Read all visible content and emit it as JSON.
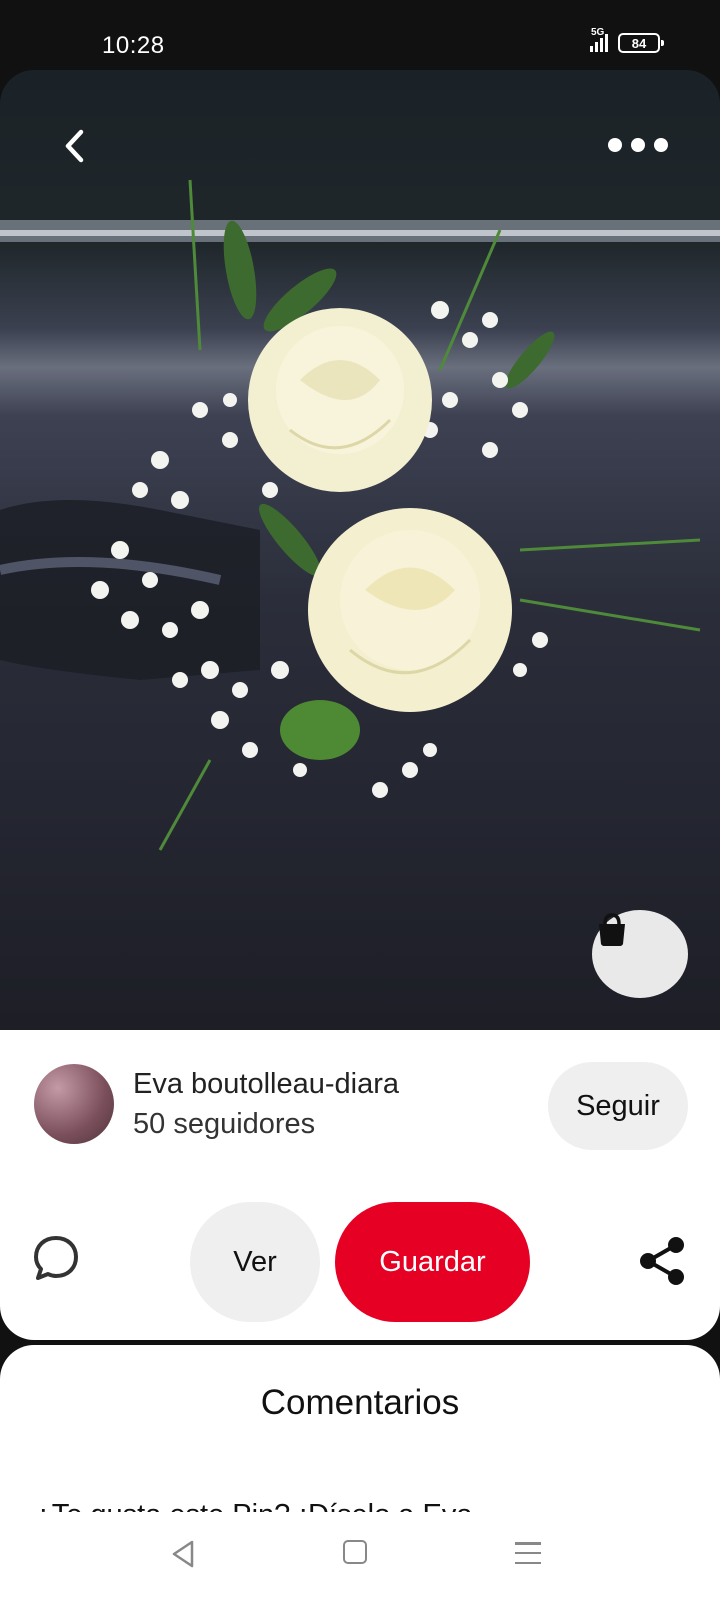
{
  "status_bar": {
    "time": "10:28",
    "network": "5G",
    "battery": "84"
  },
  "pin": {
    "image_description_icon": "photo",
    "back_icon": "chevron-left-icon",
    "more_icon": "more-horizontal-icon",
    "shop_icon": "shopping-bag-icon"
  },
  "creator": {
    "name": "Eva boutolleau-diara",
    "followers": "50 seguidores",
    "follow_label": "Seguir"
  },
  "actions": {
    "view_label": "Ver",
    "save_label": "Guardar",
    "save_color": "#e60023"
  },
  "comments": {
    "title": "Comentarios",
    "prompt": "¿Te gusta este Pin? ¡Díselo a Eva"
  },
  "nav": {
    "back_icon": "triangle-back-icon",
    "home_icon": "square-home-icon",
    "menu_icon": "menu-icon"
  }
}
